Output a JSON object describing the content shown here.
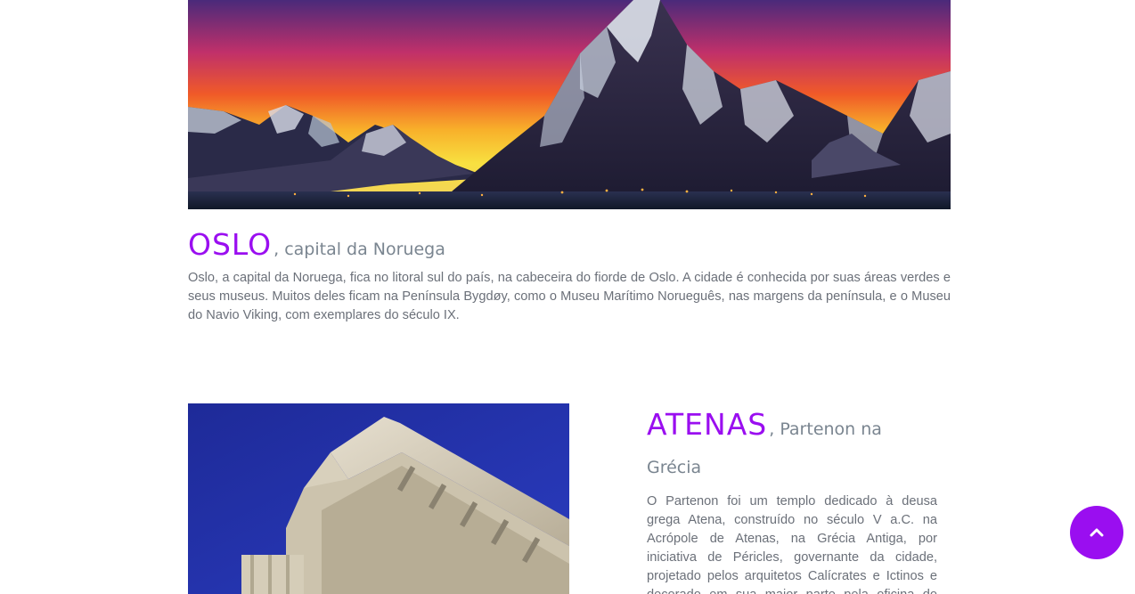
{
  "colors": {
    "accent": "#9a0ef0",
    "subtitle": "#7a8590",
    "body_text": "#6b7079"
  },
  "oslo": {
    "image_icon": "mountains-sunset-image",
    "name": "OSLO",
    "subtitle": ", capital da Noruega",
    "description": "Oslo, a capital da Noruega, fica no litoral sul do país, na cabeceira do fiorde de Oslo. A cidade é conhecida por suas áreas verdes e seus museus. Muitos deles ficam na Península Bygdøy, como o Museu Marítimo Norueguês, nas margens da península, e o Museu do Navio Viking, com exemplares do século IX."
  },
  "atenas": {
    "image_icon": "parthenon-image",
    "name": "ATENAS",
    "subtitle": ", Partenon na Grécia",
    "description": "O Partenon foi um templo dedicado à deusa grega Atena, construído no século V a.C. na Acrópole de Atenas, na Grécia Antiga, por iniciativa de Péricles, governante da cidade, projetado pelos arquitetos Calícrates e Ictinos e decorado em sua maior parte pela oficina do escultor Fídias, que também"
  },
  "scroll_top": {
    "icon": "chevron-up-icon"
  }
}
